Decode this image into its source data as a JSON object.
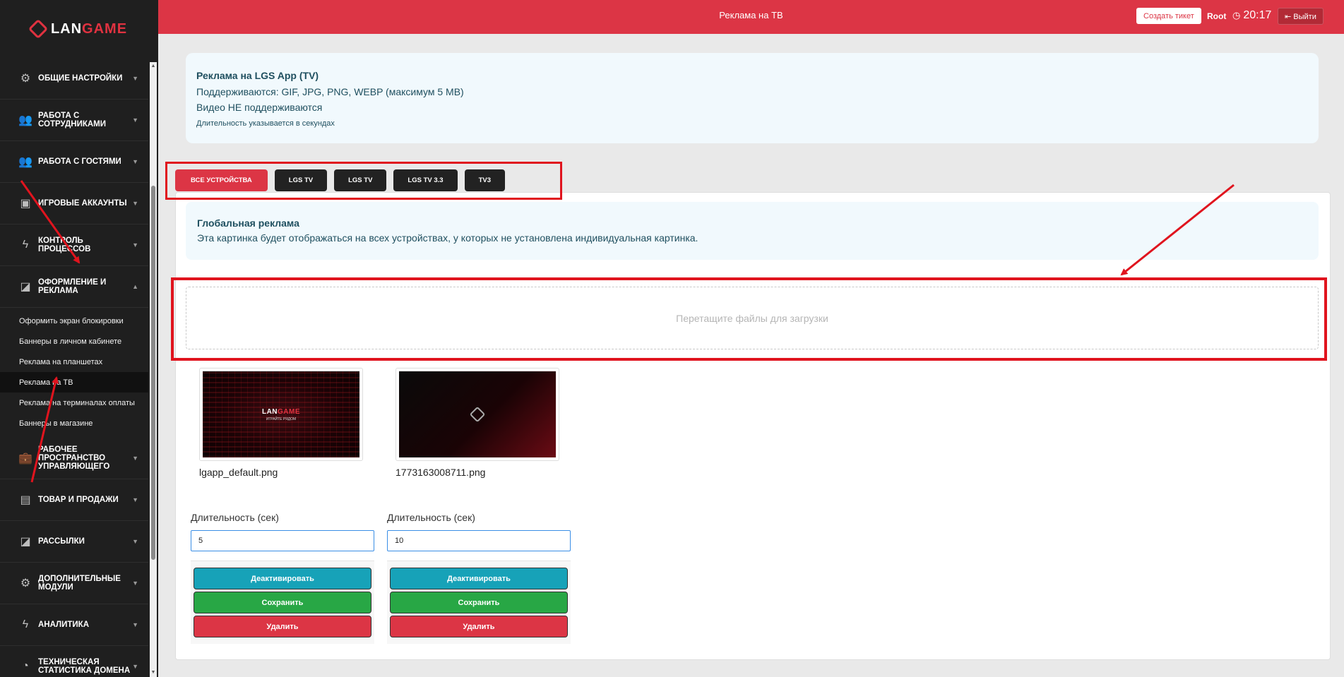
{
  "app": {
    "logo_lan": "LAN",
    "logo_game": "GAME"
  },
  "sidebar": {
    "items": [
      {
        "label": "Общие настройки",
        "icon": "gear-icon"
      },
      {
        "label": "Работа с сотрудниками",
        "icon": "users-icon"
      },
      {
        "label": "Работа с гостями",
        "icon": "users-icon"
      },
      {
        "label": "Игровые аккаунты",
        "icon": "account-icon"
      },
      {
        "label": "Контроль процессов",
        "icon": "bolt-icon"
      },
      {
        "label": "Оформление и реклама",
        "icon": "edit-icon"
      }
    ],
    "sub_items": [
      {
        "label": "Оформить экран блокировки"
      },
      {
        "label": "Баннеры в личном кабинете"
      },
      {
        "label": "Реклама на планшетах"
      },
      {
        "label": "Реклама на ТВ"
      },
      {
        "label": "Реклама на терминалах оплаты"
      },
      {
        "label": "Баннеры в магазине"
      }
    ],
    "items_after": [
      {
        "label": "Рабочее пространство управляющего",
        "icon": "briefcase-icon"
      },
      {
        "label": "Товар и продажи",
        "icon": "note-icon"
      },
      {
        "label": "Рассылки",
        "icon": "edit-icon"
      },
      {
        "label": "Дополнительные модули",
        "icon": "gear-icon"
      },
      {
        "label": "Аналитика",
        "icon": "bolt-icon"
      },
      {
        "label": "Техническая статистика домена",
        "icon": "pie-icon"
      }
    ]
  },
  "header": {
    "title": "Реклама на ТВ",
    "ticket_button": "Создать тикет",
    "user": "Root",
    "time": "20:17",
    "logout": "Выйти"
  },
  "info": {
    "title": "Реклама на LGS App (TV)",
    "line1": "Поддерживаются: GIF, JPG, PNG, WEBP (максимум 5 MB)",
    "line2": "Видео НЕ поддерживаются",
    "note": "Длительность указывается в секундах"
  },
  "tabs": [
    {
      "label": "ВСЕ УСТРОЙСТВА",
      "active": true
    },
    {
      "label": "LGS TV",
      "active": false
    },
    {
      "label": "LGS TV",
      "active": false
    },
    {
      "label": "LGS TV 3.3",
      "active": false
    },
    {
      "label": "TV3",
      "active": false
    }
  ],
  "global": {
    "title": "Глобальная реклама",
    "text": "Эта картинка будет отображаться на всех устройствах, у которых не установлена индивидуальная картинка."
  },
  "dropzone": {
    "text": "Перетащите файлы для загрузки"
  },
  "media": [
    {
      "file_name": "lgapp_default.png",
      "thumb_logo_lan": "LAN",
      "thumb_logo_game": "GAME",
      "thumb_sub": "ИГРАЙТЕ РЯДОМ",
      "duration_label": "Длительность (сек)",
      "duration_value": "5",
      "deactivate": "Деактивировать",
      "save": "Сохранить",
      "delete": "Удалить"
    },
    {
      "file_name": "1773163008711.png",
      "duration_label": "Длительность (сек)",
      "duration_value": "10",
      "deactivate": "Деактивировать",
      "save": "Сохранить",
      "delete": "Удалить"
    }
  ],
  "colors": {
    "brand_red": "#dc3545",
    "sidebar_bg": "#1f1f1f",
    "info_bg": "#f1f9fd",
    "button_teal": "#17a2b8",
    "button_green": "#28a745",
    "annotation_red": "#e0141e"
  }
}
